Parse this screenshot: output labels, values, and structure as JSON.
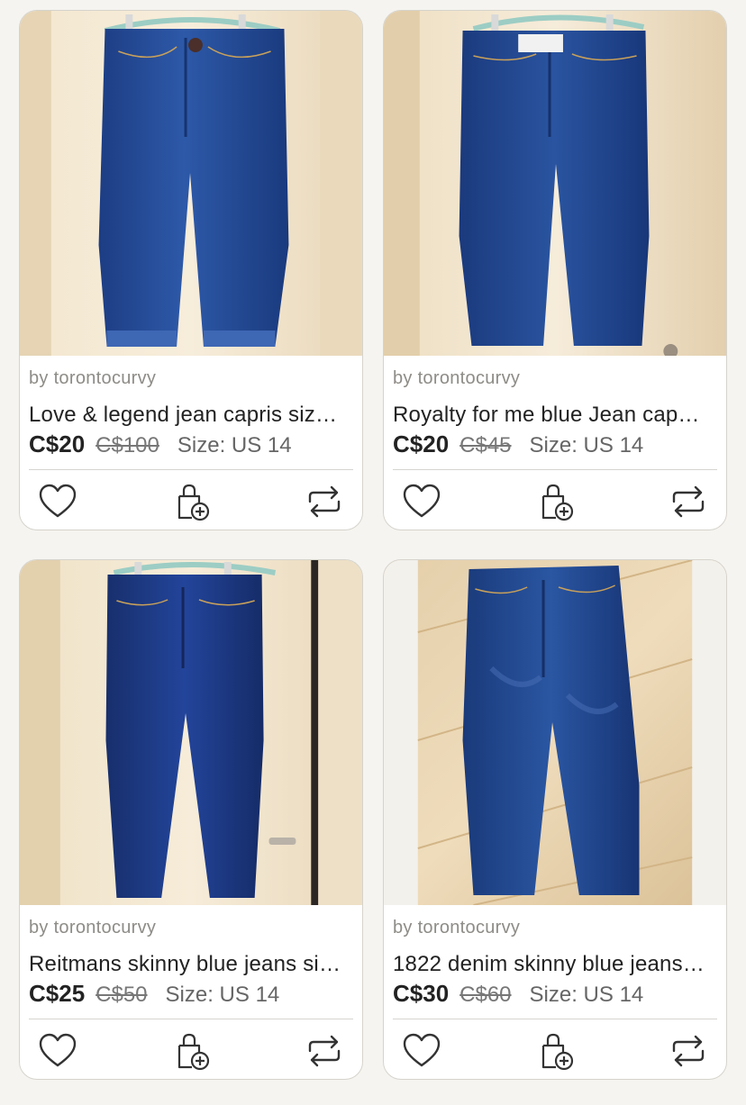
{
  "listings": [
    {
      "seller": "by torontocurvy",
      "title": "Love & legend jean capris siz…",
      "price": "C$20",
      "original_price": "C$100",
      "size": "Size: US 14",
      "photo": "capri-jeans-hanging"
    },
    {
      "seller": "by torontocurvy",
      "title": "Royalty for me blue Jean cap…",
      "price": "C$20",
      "original_price": "C$45",
      "size": "Size: US 14",
      "photo": "capri-jeans-hanging"
    },
    {
      "seller": "by torontocurvy",
      "title": "Reitmans skinny blue jeans si…",
      "price": "C$25",
      "original_price": "C$50",
      "size": "Size: US 14",
      "photo": "skinny-jeans-hanging"
    },
    {
      "seller": "by torontocurvy",
      "title": "1822 denim skinny blue jeans…",
      "price": "C$30",
      "original_price": "C$60",
      "size": "Size: US 14",
      "photo": "skinny-jeans-on-floor"
    }
  ],
  "icons": {
    "like": "heart-icon",
    "bag": "add-to-bag-icon",
    "share": "repost-icon"
  },
  "colors": {
    "background": "#f5f4f0",
    "card": "#ffffff",
    "denim": "#1f3f86",
    "wall": "#efe2c9"
  }
}
